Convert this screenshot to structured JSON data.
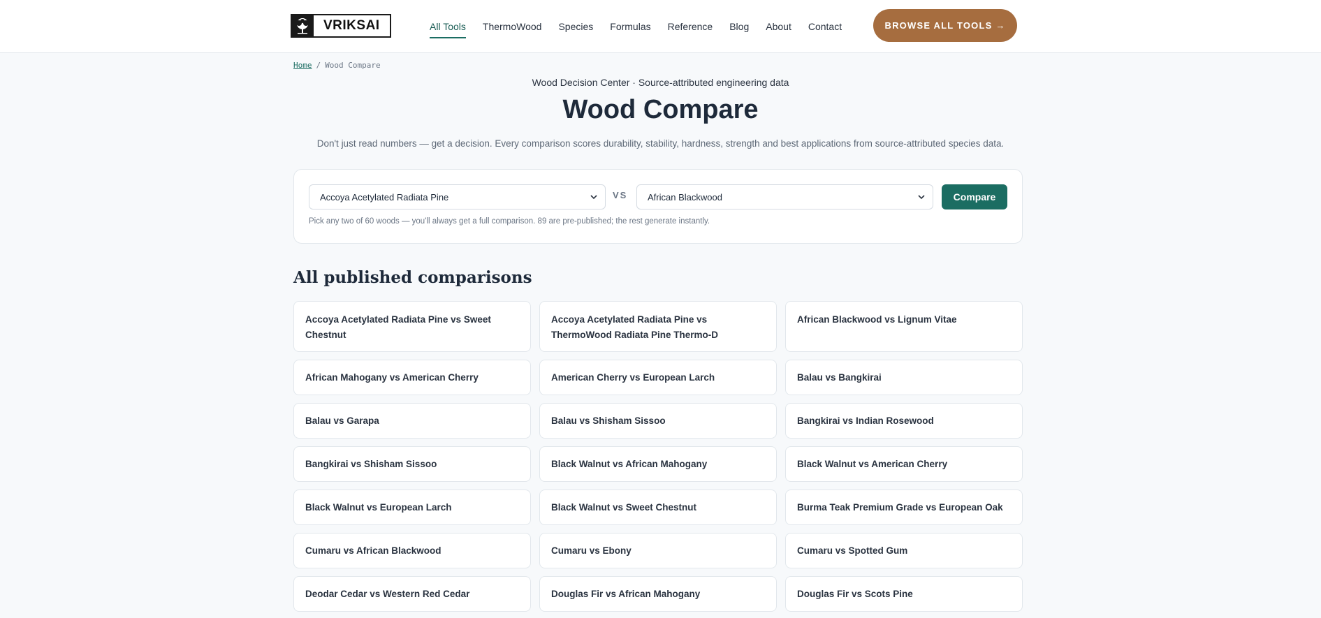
{
  "header": {
    "logo_text": "VRIKSAI",
    "nav": [
      {
        "label": "All Tools",
        "active": true
      },
      {
        "label": "ThermoWood",
        "active": false
      },
      {
        "label": "Species",
        "active": false
      },
      {
        "label": "Formulas",
        "active": false
      },
      {
        "label": "Reference",
        "active": false
      },
      {
        "label": "Blog",
        "active": false
      },
      {
        "label": "About",
        "active": false
      },
      {
        "label": "Contact",
        "active": false
      }
    ],
    "cta_label": "BROWSE ALL TOOLS →"
  },
  "breadcrumb": {
    "home": "Home",
    "separator": "/",
    "current": "Wood Compare"
  },
  "hero": {
    "eyebrow": "Wood Decision Center · Source-attributed engineering data",
    "title": "Wood Compare",
    "subtitle": "Don't just read numbers — get a decision. Every comparison scores durability, stability, hardness, strength and best applications from source-attributed species data."
  },
  "compare": {
    "select_a": "Accoya Acetylated Radiata Pine",
    "vs_label": "VS",
    "select_b": "African Blackwood",
    "button_label": "Compare",
    "hint": "Pick any two of 60 woods — you'll always get a full comparison. 89 are pre-published; the rest generate instantly."
  },
  "comparisons": {
    "title": "All published comparisons",
    "items": [
      "Accoya Acetylated Radiata Pine vs Sweet Chestnut",
      "Accoya Acetylated Radiata Pine vs ThermoWood Radiata Pine Thermo-D",
      "African Blackwood vs Lignum Vitae",
      "African Mahogany vs American Cherry",
      "American Cherry vs European Larch",
      "Balau vs Bangkirai",
      "Balau vs Garapa",
      "Balau vs Shisham Sissoo",
      "Bangkirai vs Indian Rosewood",
      "Bangkirai vs Shisham Sissoo",
      "Black Walnut vs African Mahogany",
      "Black Walnut vs American Cherry",
      "Black Walnut vs European Larch",
      "Black Walnut vs Sweet Chestnut",
      "Burma Teak Premium Grade vs European Oak",
      "Cumaru vs African Blackwood",
      "Cumaru vs Ebony",
      "Cumaru vs Spotted Gum",
      "Deodar Cedar vs Western Red Cedar",
      "Douglas Fir vs African Mahogany",
      "Douglas Fir vs Scots Pine"
    ]
  },
  "colors": {
    "accent": "#1b6d62",
    "cta": "#a66d3f",
    "background": "#f7f9fb"
  }
}
